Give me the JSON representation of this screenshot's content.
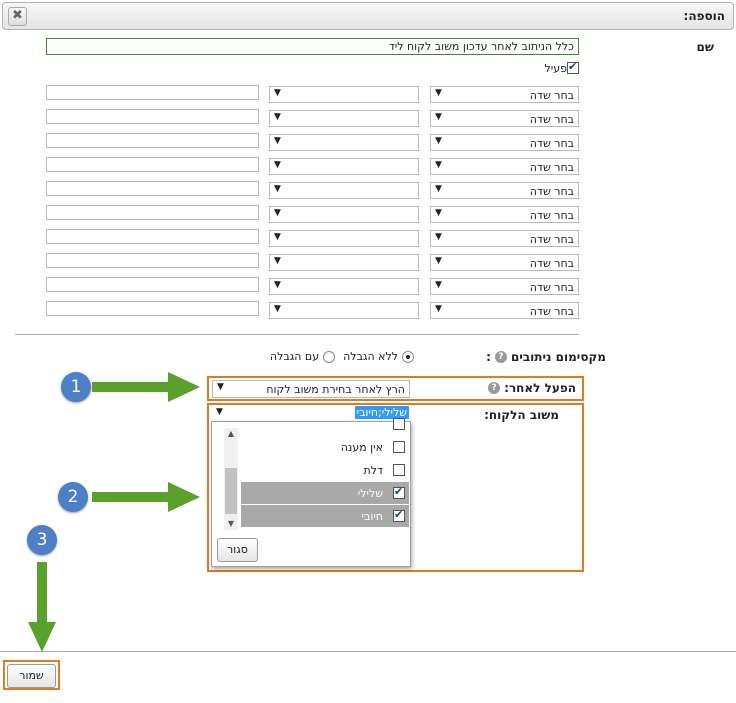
{
  "window": {
    "title": "הוספה:",
    "close_icon": "✖"
  },
  "form": {
    "name_label": "שם",
    "name_value": "כלל הניתוב לאחר עדכון משוב לקוח ליד",
    "active_label": "פעיל",
    "field_placeholder": "בחר שדה",
    "max_routings_label": "מקסימום ניתובים",
    "colon": ":",
    "help_icon": "?",
    "radio_no_limit": "ללא הגבלה",
    "radio_with_limit": "עם הגבלה",
    "trigger_label": "הפעל לאחר:",
    "trigger_value": "הרץ לאחר בחירת משוב לקוח",
    "feedback_label": "משוב הלקוח:",
    "feedback_selected": "שלילי;חיובי",
    "dropdown_arrow": "▼"
  },
  "feedback_options": [
    {
      "label": "אין מענה",
      "checked": false
    },
    {
      "label": "דלת",
      "checked": false
    },
    {
      "label": "שלילי",
      "checked": true
    },
    {
      "label": "חיובי",
      "checked": true
    }
  ],
  "popup": {
    "close_label": "סגור",
    "scroll_up": "▲",
    "scroll_down": "▼"
  },
  "footer": {
    "save_label": "שמור"
  },
  "markers": [
    "1",
    "2",
    "3"
  ],
  "colors": {
    "highlight": "#e07b20",
    "arrow": "#5aa02c",
    "marker": "#4d7fc7",
    "selection": "#3399ff"
  }
}
